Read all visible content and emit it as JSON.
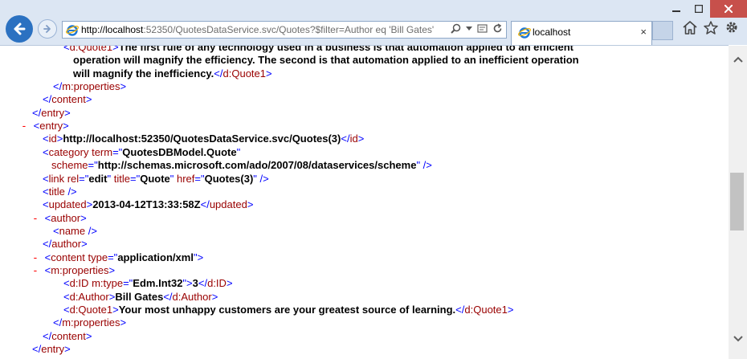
{
  "browser": {
    "address": {
      "host": "http://localhost",
      "path": ":52350/QuotesDataService.svc/Quotes?$filter=Author eq 'Bill Gates'"
    },
    "tab": {
      "title": "localhost",
      "close": "×"
    },
    "icons": [
      "back-arrow-icon",
      "forward-arrow-icon",
      "ie-icon",
      "search-icon",
      "dropdown-icon",
      "compat-icon",
      "refresh-icon",
      "home-icon",
      "favorites-star-icon",
      "settings-gear-icon",
      "minimize-icon",
      "maximize-icon",
      "close-icon"
    ]
  },
  "xml": {
    "lines": [
      {
        "indent": 0,
        "parts": [
          {
            "c": "p",
            "s": "<"
          },
          {
            "c": "t",
            "s": "d:Quote1"
          },
          {
            "c": "p",
            "s": ">"
          },
          {
            "c": "v",
            "s": "The first rule of any technology used in a business is that automation applied to an efficient"
          }
        ]
      },
      {
        "indent": 1,
        "parts": [
          {
            "c": "v",
            "s": "operation will magnify the efficiency. The second is that automation applied to an inefficient operation"
          }
        ]
      },
      {
        "indent": 1,
        "parts": [
          {
            "c": "v",
            "s": "will magnify the inefficiency."
          },
          {
            "c": "p",
            "s": "</"
          },
          {
            "c": "t",
            "s": "d:Quote1"
          },
          {
            "c": "p",
            "s": ">"
          }
        ]
      },
      {
        "indent": 2,
        "parts": [
          {
            "c": "p",
            "s": "</"
          },
          {
            "c": "t",
            "s": "m:properties"
          },
          {
            "c": "p",
            "s": ">"
          }
        ]
      },
      {
        "indent": 3,
        "parts": [
          {
            "c": "p",
            "s": "</"
          },
          {
            "c": "t",
            "s": "content"
          },
          {
            "c": "p",
            "s": ">"
          }
        ]
      },
      {
        "indent": 4,
        "parts": [
          {
            "c": "p",
            "s": "</"
          },
          {
            "c": "t",
            "s": "entry"
          },
          {
            "c": "p",
            "s": ">"
          }
        ]
      },
      {
        "indent": 5,
        "parts": [
          {
            "c": "m",
            "s": "- "
          },
          {
            "c": "p",
            "s": "<"
          },
          {
            "c": "t",
            "s": "entry"
          },
          {
            "c": "p",
            "s": ">"
          }
        ]
      },
      {
        "indent": 6,
        "parts": [
          {
            "c": "p",
            "s": "<"
          },
          {
            "c": "t",
            "s": "id"
          },
          {
            "c": "p",
            "s": ">"
          },
          {
            "c": "v",
            "s": "http://localhost:52350/QuotesDataService.svc/Quotes(3)"
          },
          {
            "c": "p",
            "s": "</"
          },
          {
            "c": "t",
            "s": "id"
          },
          {
            "c": "p",
            "s": ">"
          }
        ]
      },
      {
        "indent": 6,
        "parts": [
          {
            "c": "p",
            "s": "<"
          },
          {
            "c": "t",
            "s": "category "
          },
          {
            "c": "t",
            "s": "term"
          },
          {
            "c": "p",
            "s": "=\""
          },
          {
            "c": "v",
            "s": "QuotesDBModel.Quote"
          },
          {
            "c": "p",
            "s": "\""
          }
        ]
      },
      {
        "indent": 7,
        "parts": [
          {
            "c": "t",
            "s": "scheme"
          },
          {
            "c": "p",
            "s": "=\""
          },
          {
            "c": "v",
            "s": "http://schemas.microsoft.com/ado/2007/08/dataservices/scheme"
          },
          {
            "c": "p",
            "s": "\" />"
          }
        ]
      },
      {
        "indent": 6,
        "parts": [
          {
            "c": "p",
            "s": "<"
          },
          {
            "c": "t",
            "s": "link "
          },
          {
            "c": "t",
            "s": "rel"
          },
          {
            "c": "p",
            "s": "=\""
          },
          {
            "c": "v",
            "s": "edit"
          },
          {
            "c": "p",
            "s": "\" "
          },
          {
            "c": "t",
            "s": "title"
          },
          {
            "c": "p",
            "s": "=\""
          },
          {
            "c": "v",
            "s": "Quote"
          },
          {
            "c": "p",
            "s": "\" "
          },
          {
            "c": "t",
            "s": "href"
          },
          {
            "c": "p",
            "s": "=\""
          },
          {
            "c": "v",
            "s": "Quotes(3)"
          },
          {
            "c": "p",
            "s": "\" />"
          }
        ]
      },
      {
        "indent": 6,
        "parts": [
          {
            "c": "p",
            "s": "<"
          },
          {
            "c": "t",
            "s": "title"
          },
          {
            "c": "p",
            "s": " />"
          }
        ]
      },
      {
        "indent": 6,
        "parts": [
          {
            "c": "p",
            "s": "<"
          },
          {
            "c": "t",
            "s": "updated"
          },
          {
            "c": "p",
            "s": ">"
          },
          {
            "c": "v",
            "s": "2013-04-12T13:33:58Z"
          },
          {
            "c": "p",
            "s": "</"
          },
          {
            "c": "t",
            "s": "updated"
          },
          {
            "c": "p",
            "s": ">"
          }
        ]
      },
      {
        "indent": 8,
        "parts": [
          {
            "c": "m",
            "s": "- "
          },
          {
            "c": "p",
            "s": "<"
          },
          {
            "c": "t",
            "s": "author"
          },
          {
            "c": "p",
            "s": ">"
          }
        ]
      },
      {
        "indent": 9,
        "parts": [
          {
            "c": "p",
            "s": "<"
          },
          {
            "c": "t",
            "s": "name"
          },
          {
            "c": "p",
            "s": " />"
          }
        ]
      },
      {
        "indent": 6,
        "parts": [
          {
            "c": "p",
            "s": "</"
          },
          {
            "c": "t",
            "s": "author"
          },
          {
            "c": "p",
            "s": ">"
          }
        ]
      },
      {
        "indent": 8,
        "parts": [
          {
            "c": "m",
            "s": "- "
          },
          {
            "c": "p",
            "s": "<"
          },
          {
            "c": "t",
            "s": "content "
          },
          {
            "c": "t",
            "s": "type"
          },
          {
            "c": "p",
            "s": "=\""
          },
          {
            "c": "v",
            "s": "application/xml"
          },
          {
            "c": "p",
            "s": "\">"
          }
        ]
      },
      {
        "indent": 10,
        "parts": [
          {
            "c": "m",
            "s": "- "
          },
          {
            "c": "p",
            "s": "<"
          },
          {
            "c": "t",
            "s": "m:properties"
          },
          {
            "c": "p",
            "s": ">"
          }
        ]
      },
      {
        "indent": 11,
        "parts": [
          {
            "c": "p",
            "s": "<"
          },
          {
            "c": "t",
            "s": "d:ID "
          },
          {
            "c": "t",
            "s": "m:type"
          },
          {
            "c": "p",
            "s": "=\""
          },
          {
            "c": "v",
            "s": "Edm.Int32"
          },
          {
            "c": "p",
            "s": "\">"
          },
          {
            "c": "v",
            "s": "3"
          },
          {
            "c": "p",
            "s": "</"
          },
          {
            "c": "t",
            "s": "d:ID"
          },
          {
            "c": "p",
            "s": ">"
          }
        ]
      },
      {
        "indent": 11,
        "parts": [
          {
            "c": "p",
            "s": "<"
          },
          {
            "c": "t",
            "s": "d:Author"
          },
          {
            "c": "p",
            "s": ">"
          },
          {
            "c": "v",
            "s": "Bill Gates"
          },
          {
            "c": "p",
            "s": "</"
          },
          {
            "c": "t",
            "s": "d:Author"
          },
          {
            "c": "p",
            "s": ">"
          }
        ]
      },
      {
        "indent": 11,
        "parts": [
          {
            "c": "p",
            "s": "<"
          },
          {
            "c": "t",
            "s": "d:Quote1"
          },
          {
            "c": "p",
            "s": ">"
          },
          {
            "c": "v",
            "s": "Your most unhappy customers are your greatest source of learning."
          },
          {
            "c": "p",
            "s": "</"
          },
          {
            "c": "t",
            "s": "d:Quote1"
          },
          {
            "c": "p",
            "s": ">"
          }
        ]
      },
      {
        "indent": 2,
        "parts": [
          {
            "c": "p",
            "s": "</"
          },
          {
            "c": "t",
            "s": "m:properties"
          },
          {
            "c": "p",
            "s": ">"
          }
        ]
      },
      {
        "indent": 3,
        "parts": [
          {
            "c": "p",
            "s": "</"
          },
          {
            "c": "t",
            "s": "content"
          },
          {
            "c": "p",
            "s": ">"
          }
        ]
      },
      {
        "indent": 4,
        "parts": [
          {
            "c": "p",
            "s": "</"
          },
          {
            "c": "t",
            "s": "entry"
          },
          {
            "c": "p",
            "s": ">"
          }
        ]
      }
    ]
  }
}
